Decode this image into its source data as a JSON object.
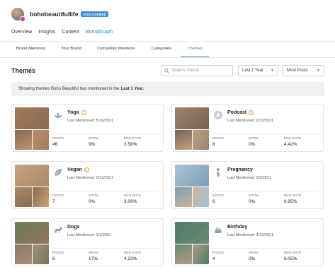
{
  "profile": {
    "username": "bohobeautifullife",
    "badge": "DISCOVERED"
  },
  "main_nav": [
    "Overview",
    "Insights",
    "Content",
    "BrandGraph"
  ],
  "sub_tabs": [
    "Brand Mentions",
    "Your Brand",
    "Competitor Mentions",
    "Categories",
    "Themes"
  ],
  "page_title": "Themes",
  "search": {
    "placeholder": "Search Theme"
  },
  "filters": {
    "period": "Last 1 Year",
    "sort": "Most Posts"
  },
  "info": {
    "prefix": "Showing themes Boho Beautiful has mentioned in the",
    "period": "Last 1 Year."
  },
  "stat_labels": {
    "posts": "POSTS",
    "spon": "SPON.",
    "eng": "ENG.RATE"
  },
  "themes": [
    {
      "name": "Yoga",
      "last_mentioned": "Last Mentioned: 5/16/2021",
      "posts": "46",
      "spon": "9%",
      "eng": "3.58%",
      "icon": "lotus-icon",
      "rank": "1"
    },
    {
      "name": "Podcast",
      "last_mentioned": "Last Mentioned: 2/13/2021",
      "posts": "8",
      "spon": "0%",
      "eng": "4.42%",
      "icon": "microphone-icon",
      "rank": "1"
    },
    {
      "name": "Vegan",
      "last_mentioned": "Last Mentioned: 2/13/2021",
      "posts": "7",
      "spon": "0%",
      "eng": "3.09%",
      "icon": "leaf-icon",
      "rank": "1"
    },
    {
      "name": "Pregnancy",
      "last_mentioned": "Last Mentioned: 2/9/2021",
      "posts": "6",
      "spon": "0%",
      "eng": "8.95%",
      "icon": "pregnancy-icon",
      "rank": ""
    },
    {
      "name": "Dogs",
      "last_mentioned": "Last Mentioned: 1/1/2021",
      "posts": "6",
      "spon": "17%",
      "eng": "4.23%",
      "icon": "dog-icon",
      "rank": ""
    },
    {
      "name": "Birthday",
      "last_mentioned": "Last Mentioned: 4/13/2021",
      "posts": "4",
      "spon": "0%",
      "eng": "6.05%",
      "icon": "cake-icon",
      "rank": ""
    }
  ],
  "colors": {
    "accent": "#2a7fd0",
    "badge": "#3b8fd9",
    "rank": "#e39a4a"
  }
}
